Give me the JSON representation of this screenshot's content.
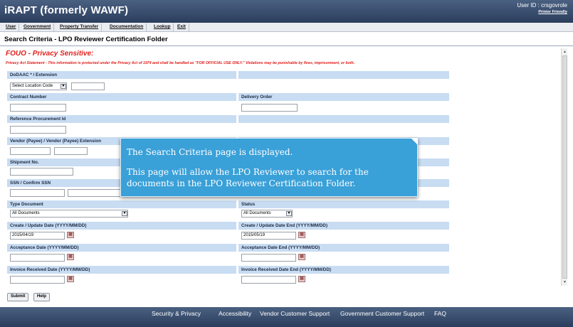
{
  "header": {
    "app_title": "iRAPT (formerly WAWF)",
    "user_id": "User ID : crsgovrole",
    "printer_friendly": "Printer Friendly"
  },
  "menu": [
    "User",
    "Government",
    "Property Transfer",
    "Documentation",
    "Lookup",
    "Exit"
  ],
  "page_title": "Search Criteria - LPO Reviewer Certification Folder",
  "fouo": "FOUO - Privacy Sensitive:",
  "privacy_statement": "Privacy Act Statement - This information is protected under the Privacy Act of 1974 and shall be handled as \"FOR OFFICIAL USE ONLY.\" Violations may be punishable by fines, imprisonment, or both.",
  "form": {
    "dodaac_label": "DoDAAC * / Extension",
    "location_code": "Select Location Code",
    "contract_number_label": "Contract Number",
    "delivery_order_label": "Delivery Order",
    "reference_procurement_label": "Reference Procurement Id",
    "vendor_label": "Vendor (Payee) / Vendor (Payee) Extension",
    "shipment_label": "Shipment No.",
    "ssn_label": "SSN / Confirm SSN",
    "type_document_label": "Type Document",
    "type_document_value": "All Documents",
    "status_label": "Status",
    "status_value": "All Documents",
    "create_date_label": "Create / Update Date (YYYY/MM/DD)",
    "create_date_value": "2015/04/19",
    "create_date_end_label": "Create / Update Date End (YYYY/MM/DD)",
    "create_date_end_value": "2015/05/19",
    "acceptance_label": "Acceptance Date (YYYY/MM/DD)",
    "acceptance_end_label": "Acceptance Date End (YYYY/MM/DD)",
    "invoice_label": "Invoice Received Date (YYYY/MM/DD)",
    "invoice_end_label": "Invoice Received Date End (YYYY/MM/DD)"
  },
  "buttons": {
    "submit": "Submit",
    "help": "Help"
  },
  "footer": [
    "Security & Privacy",
    "Accessibility",
    "Vendor Customer Support",
    "Government Customer Support",
    "FAQ"
  ],
  "callout": {
    "line1": "The Search Criteria page is displayed.",
    "line2": "This page will allow the LPO Reviewer to search for the",
    "line3": "documents in the LPO Reviewer Certification Folder."
  }
}
